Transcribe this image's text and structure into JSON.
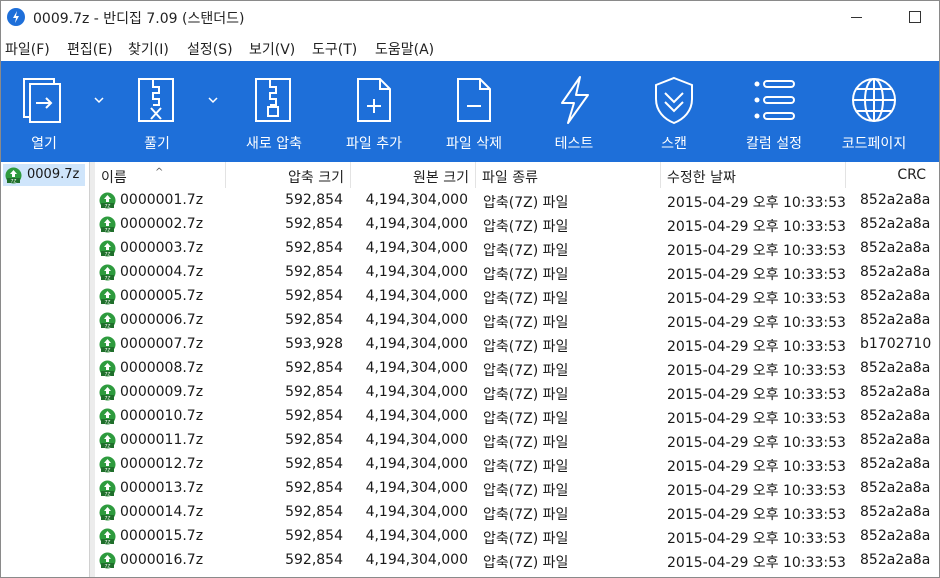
{
  "window": {
    "title": "0009.7z - 반디집 7.09 (스탠더드)"
  },
  "menu": [
    "파일(F)",
    "편집(E)",
    "찾기(I)",
    "설정(S)",
    "보기(V)",
    "도구(T)",
    "도움말(A)"
  ],
  "toolbar": {
    "open": "열기",
    "extract": "풀기",
    "new_archive": "새로 압축",
    "add_files": "파일 추가",
    "delete_files": "파일 삭제",
    "test": "테스트",
    "scan": "스캔",
    "columns": "칼럼 설정",
    "codepage": "코드페이지"
  },
  "sidebar": {
    "archive": "0009.7z"
  },
  "columns": {
    "name": "이름",
    "packed": "압축 크기",
    "size": "원본 크기",
    "type": "파일 종류",
    "modified": "수정한 날짜",
    "crc": "CRC"
  },
  "files": [
    {
      "name": "0000001.7z",
      "packed": "592,854",
      "size": "4,194,304,000",
      "type": "압축(7Z) 파일",
      "modified": "2015-04-29 오후 10:33:53",
      "crc": "852a2a8a"
    },
    {
      "name": "0000002.7z",
      "packed": "592,854",
      "size": "4,194,304,000",
      "type": "압축(7Z) 파일",
      "modified": "2015-04-29 오후 10:33:53",
      "crc": "852a2a8a"
    },
    {
      "name": "0000003.7z",
      "packed": "592,854",
      "size": "4,194,304,000",
      "type": "압축(7Z) 파일",
      "modified": "2015-04-29 오후 10:33:53",
      "crc": "852a2a8a"
    },
    {
      "name": "0000004.7z",
      "packed": "592,854",
      "size": "4,194,304,000",
      "type": "압축(7Z) 파일",
      "modified": "2015-04-29 오후 10:33:53",
      "crc": "852a2a8a"
    },
    {
      "name": "0000005.7z",
      "packed": "592,854",
      "size": "4,194,304,000",
      "type": "압축(7Z) 파일",
      "modified": "2015-04-29 오후 10:33:53",
      "crc": "852a2a8a"
    },
    {
      "name": "0000006.7z",
      "packed": "592,854",
      "size": "4,194,304,000",
      "type": "압축(7Z) 파일",
      "modified": "2015-04-29 오후 10:33:53",
      "crc": "852a2a8a"
    },
    {
      "name": "0000007.7z",
      "packed": "593,928",
      "size": "4,194,304,000",
      "type": "압축(7Z) 파일",
      "modified": "2015-04-29 오후 10:33:53",
      "crc": "b1702710"
    },
    {
      "name": "0000008.7z",
      "packed": "592,854",
      "size": "4,194,304,000",
      "type": "압축(7Z) 파일",
      "modified": "2015-04-29 오후 10:33:53",
      "crc": "852a2a8a"
    },
    {
      "name": "0000009.7z",
      "packed": "592,854",
      "size": "4,194,304,000",
      "type": "압축(7Z) 파일",
      "modified": "2015-04-29 오후 10:33:53",
      "crc": "852a2a8a"
    },
    {
      "name": "0000010.7z",
      "packed": "592,854",
      "size": "4,194,304,000",
      "type": "압축(7Z) 파일",
      "modified": "2015-04-29 오후 10:33:53",
      "crc": "852a2a8a"
    },
    {
      "name": "0000011.7z",
      "packed": "592,854",
      "size": "4,194,304,000",
      "type": "압축(7Z) 파일",
      "modified": "2015-04-29 오후 10:33:53",
      "crc": "852a2a8a"
    },
    {
      "name": "0000012.7z",
      "packed": "592,854",
      "size": "4,194,304,000",
      "type": "압축(7Z) 파일",
      "modified": "2015-04-29 오후 10:33:53",
      "crc": "852a2a8a"
    },
    {
      "name": "0000013.7z",
      "packed": "592,854",
      "size": "4,194,304,000",
      "type": "압축(7Z) 파일",
      "modified": "2015-04-29 오후 10:33:53",
      "crc": "852a2a8a"
    },
    {
      "name": "0000014.7z",
      "packed": "592,854",
      "size": "4,194,304,000",
      "type": "압축(7Z) 파일",
      "modified": "2015-04-29 오후 10:33:53",
      "crc": "852a2a8a"
    },
    {
      "name": "0000015.7z",
      "packed": "592,854",
      "size": "4,194,304,000",
      "type": "압축(7Z) 파일",
      "modified": "2015-04-29 오후 10:33:53",
      "crc": "852a2a8a"
    },
    {
      "name": "0000016.7z",
      "packed": "592,854",
      "size": "4,194,304,000",
      "type": "압축(7Z) 파일",
      "modified": "2015-04-29 오후 10:33:53",
      "crc": "852a2a8a"
    }
  ],
  "colors": {
    "toolbar": "#1e6fd9",
    "selection": "#cfe5fb",
    "archive_icon": "#2e9b3e"
  }
}
